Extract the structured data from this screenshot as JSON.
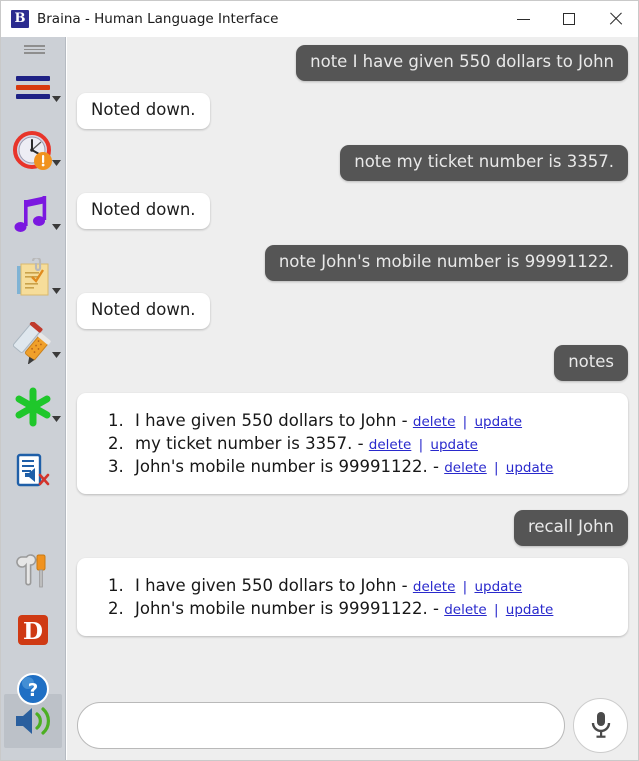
{
  "window": {
    "title": "Braina - Human Language Interface",
    "logo_letter": "B",
    "controls": {
      "minimize": "minimize-button",
      "maximize": "maximize-button",
      "close": "close-button"
    }
  },
  "sidebar": {
    "items": [
      {
        "icon": "menu-icon",
        "label": "Menu",
        "has_caret": true,
        "selected": false
      },
      {
        "icon": "alarm-clock-icon",
        "label": "Alarm",
        "has_caret": true,
        "selected": false
      },
      {
        "icon": "music-note-icon",
        "label": "Music",
        "has_caret": true,
        "selected": false
      },
      {
        "icon": "notepad-icon",
        "label": "Notes",
        "has_caret": true,
        "selected": false
      },
      {
        "icon": "medicine-reminder-icon",
        "label": "Medicine Reminder",
        "has_caret": true,
        "selected": false
      },
      {
        "icon": "green-asterisk-icon",
        "label": "Shortcuts",
        "has_caret": true,
        "selected": false
      },
      {
        "icon": "dictation-off-icon",
        "label": "Dictation",
        "has_caret": false,
        "selected": false
      },
      {
        "icon": "tools-icon",
        "label": "Settings",
        "has_caret": false,
        "selected": false
      },
      {
        "icon": "dictionary-icon",
        "label": "Dictionary",
        "has_caret": false,
        "selected": false,
        "letter": "D"
      },
      {
        "icon": "help-icon",
        "label": "Help",
        "has_caret": false,
        "selected": false,
        "letter": "?"
      },
      {
        "icon": "speaker-on-icon",
        "label": "Speech Output",
        "has_caret": false,
        "selected": true
      }
    ]
  },
  "chat": {
    "messages": [
      {
        "role": "user",
        "text": "note I have given 550 dollars to John"
      },
      {
        "role": "bot",
        "text": "Noted down."
      },
      {
        "role": "user",
        "text": "note my ticket number is 3357."
      },
      {
        "role": "bot",
        "text": "Noted down."
      },
      {
        "role": "user",
        "text": "note John's mobile number is 99991122."
      },
      {
        "role": "bot",
        "text": "Noted down."
      },
      {
        "role": "user",
        "text": "notes"
      },
      {
        "role": "bot-list",
        "items": [
          {
            "text": "I have given 550 dollars to John -",
            "delete": "delete",
            "update": "update",
            "pipe": "|"
          },
          {
            "text": "my ticket number is 3357. -",
            "delete": "delete",
            "update": "update",
            "pipe": "|"
          },
          {
            "text": "John's mobile number is 99991122. -",
            "delete": "delete",
            "update": "update",
            "pipe": "|"
          }
        ]
      },
      {
        "role": "user",
        "text": "recall John"
      },
      {
        "role": "bot-list",
        "items": [
          {
            "text": "I have given 550 dollars to John -",
            "delete": "delete",
            "update": "update",
            "pipe": "|"
          },
          {
            "text": "John's mobile number is 99991122. -",
            "delete": "delete",
            "update": "update",
            "pipe": "|"
          }
        ]
      }
    ]
  },
  "composer": {
    "input_value": "",
    "input_placeholder": "",
    "mic_icon": "microphone-icon"
  },
  "colors": {
    "user_bubble": "#555555",
    "bot_bubble": "#ffffff",
    "chat_background": "#eeeeee",
    "sidebar_background": "#ccd0d6",
    "link": "#2929cc",
    "logo_background": "#2b2b8f"
  }
}
